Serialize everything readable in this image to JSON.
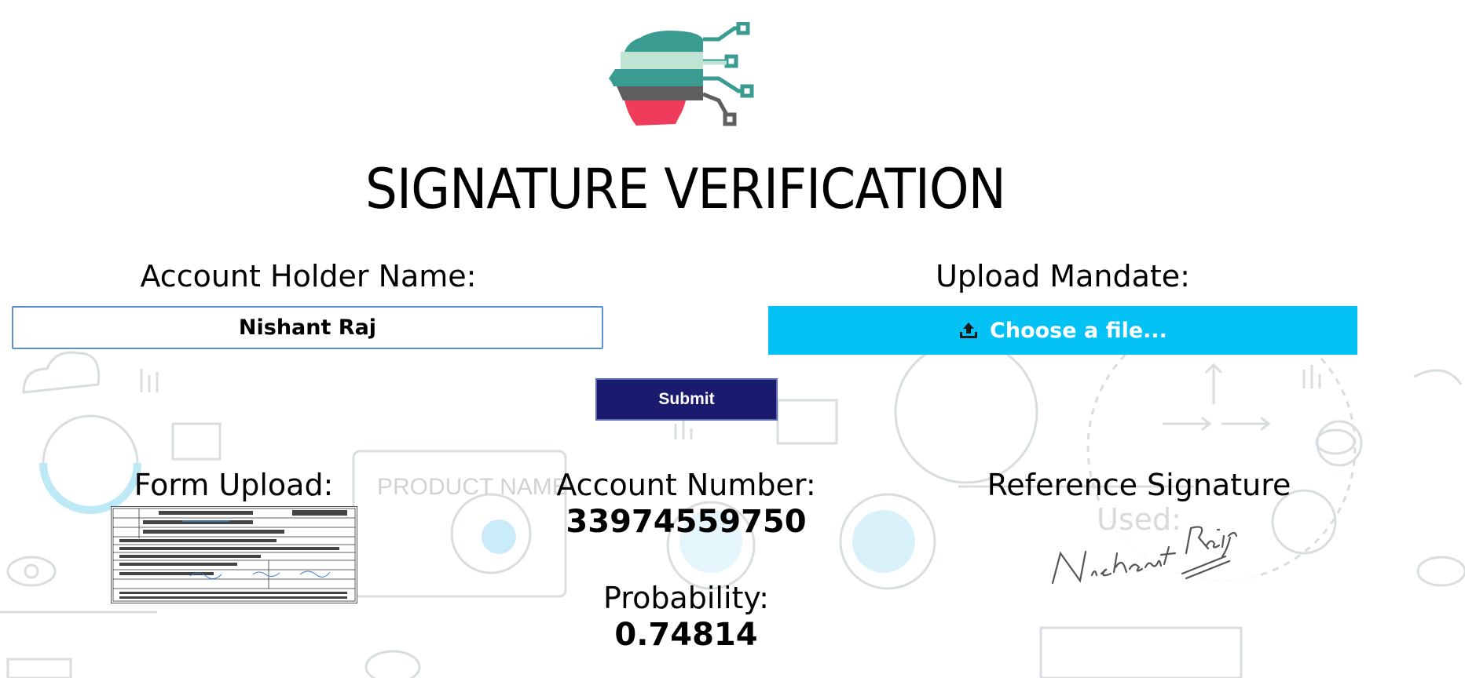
{
  "header": {
    "logo_icon": "ai-head-circuit-logo",
    "title": "SIGNATURE VERIFICATION"
  },
  "form": {
    "name_label": "Account Holder Name:",
    "name_value": "Nishant Raj",
    "upload_label": "Upload Mandate:",
    "upload_button_label": "Choose a file...",
    "upload_icon": "upload-tray-icon",
    "submit_label": "Submit"
  },
  "results": {
    "form_upload_label": "Form Upload:",
    "account_number_label": "Account Number:",
    "account_number_value": "33974559750",
    "probability_label": "Probability:",
    "probability_value": "0.74814",
    "reference_signature_label": "Reference Signature Used:",
    "reference_signature_text": "Nishant Raj"
  },
  "background": {
    "illustration_text": "PRODUCT NAME"
  },
  "colors": {
    "upload_button": "#05c2f5",
    "submit_button": "#1a1a6e",
    "input_border": "#5b8fd6",
    "logo_teal": "#3a9b91",
    "logo_mint": "#bfe4d3",
    "logo_gray": "#5f5f61",
    "logo_red": "#ee3c5a"
  }
}
